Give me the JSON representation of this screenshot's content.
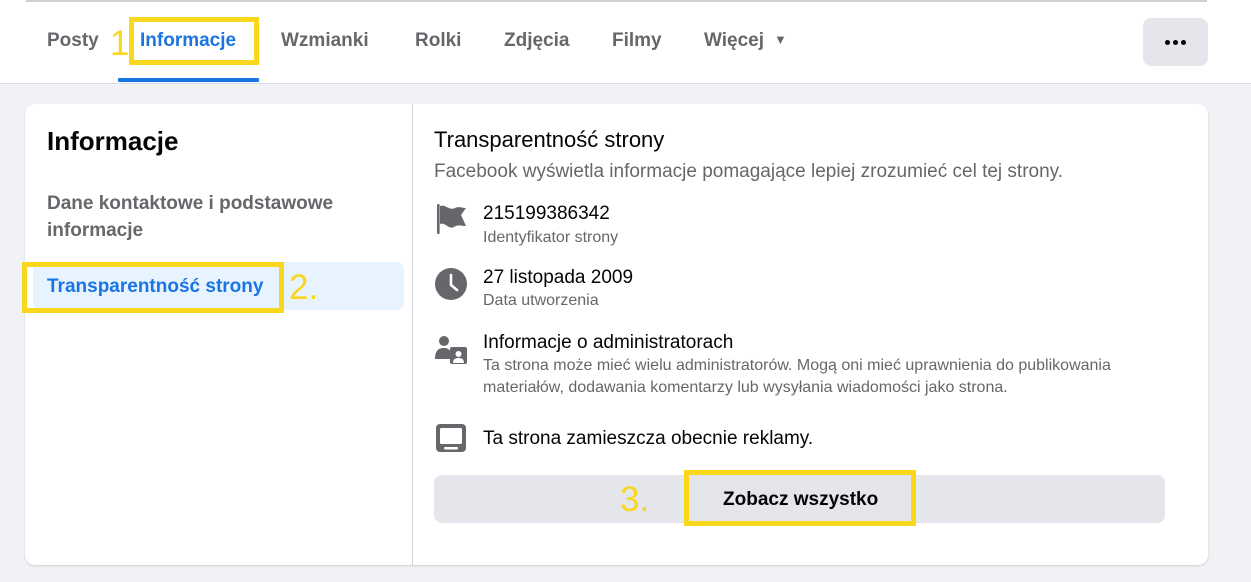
{
  "tabs": [
    {
      "label": "Posty"
    },
    {
      "label": "Informacje"
    },
    {
      "label": "Wzmianki"
    },
    {
      "label": "Rolki"
    },
    {
      "label": "Zdjęcia"
    },
    {
      "label": "Filmy"
    },
    {
      "label": "Więcej"
    }
  ],
  "more_caret": "▼",
  "annotations": {
    "first": "1",
    "second": "2.",
    "third": "3."
  },
  "sidebar": {
    "title": "Informacje",
    "items": [
      {
        "label": "Dane kontaktowe i podstawowe informacje",
        "active": false
      },
      {
        "label": "Transparentność strony",
        "active": true
      }
    ]
  },
  "section": {
    "title": "Transparentność strony",
    "subtitle": "Facebook wyświetla informacje pomagające lepiej zrozumieć cel tej strony.",
    "rows": [
      {
        "icon": "flag-icon",
        "main": "215199386342",
        "sub": "Identyfikator strony"
      },
      {
        "icon": "clock-icon",
        "main": "27 listopada 2009",
        "sub": "Data utworzenia"
      },
      {
        "icon": "admins-icon",
        "main": "Informacje o administratorach",
        "sub": "Ta strona może mieć wielu administratorów. Mogą oni mieć uprawnienia do publikowania materiałów, dodawania komentarzy lub wysyłania wiadomości jako strona."
      },
      {
        "icon": "monitor-icon",
        "main": "Ta strona zamieszcza obecnie reklamy."
      }
    ],
    "see_all_label": "Zobacz wszystko"
  },
  "colors": {
    "accent": "#1b74e4",
    "highlight": "#f9d71c",
    "secondary_text": "#65676b",
    "background": "#f0f2f5"
  }
}
